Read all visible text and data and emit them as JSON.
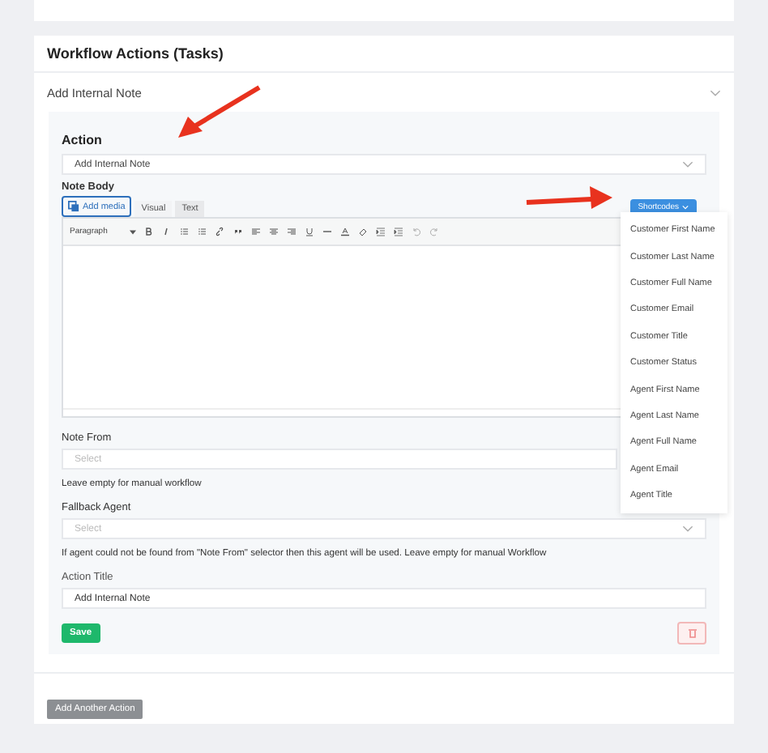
{
  "section": {
    "title": "Workflow Actions (Tasks)"
  },
  "action_item": {
    "title": "Add Internal Note",
    "expanded": true
  },
  "action": {
    "label": "Action",
    "value": "Add Internal Note"
  },
  "note_body": {
    "label": "Note Body",
    "add_media": "Add media",
    "tabs": [
      {
        "label": "Visual",
        "selected": true
      },
      {
        "label": "Text",
        "selected": false
      }
    ],
    "format_select": "Paragraph",
    "shortcodes": {
      "label": "Shortcodes",
      "expanded": true,
      "items": [
        "Customer First Name",
        "Customer Last Name",
        "Customer Full Name",
        "Customer Email",
        "Customer Title",
        "Customer Status",
        "Agent First Name",
        "Agent Last Name",
        "Agent Full Name",
        "Agent Email",
        "Agent Title"
      ]
    }
  },
  "note_from": {
    "label": "Note From",
    "placeholder": "Select",
    "help": "Leave empty for manual workflow"
  },
  "fallback_agent": {
    "label": "Fallback Agent",
    "placeholder": "Select",
    "help": "If agent could not be found from \"Note From\" selector then this agent will be used. Leave empty for manual Workflow"
  },
  "action_title": {
    "label": "Action Title",
    "value": "Add Internal Note"
  },
  "buttons": {
    "save": "Save",
    "add_another": "Add Another Action"
  }
}
